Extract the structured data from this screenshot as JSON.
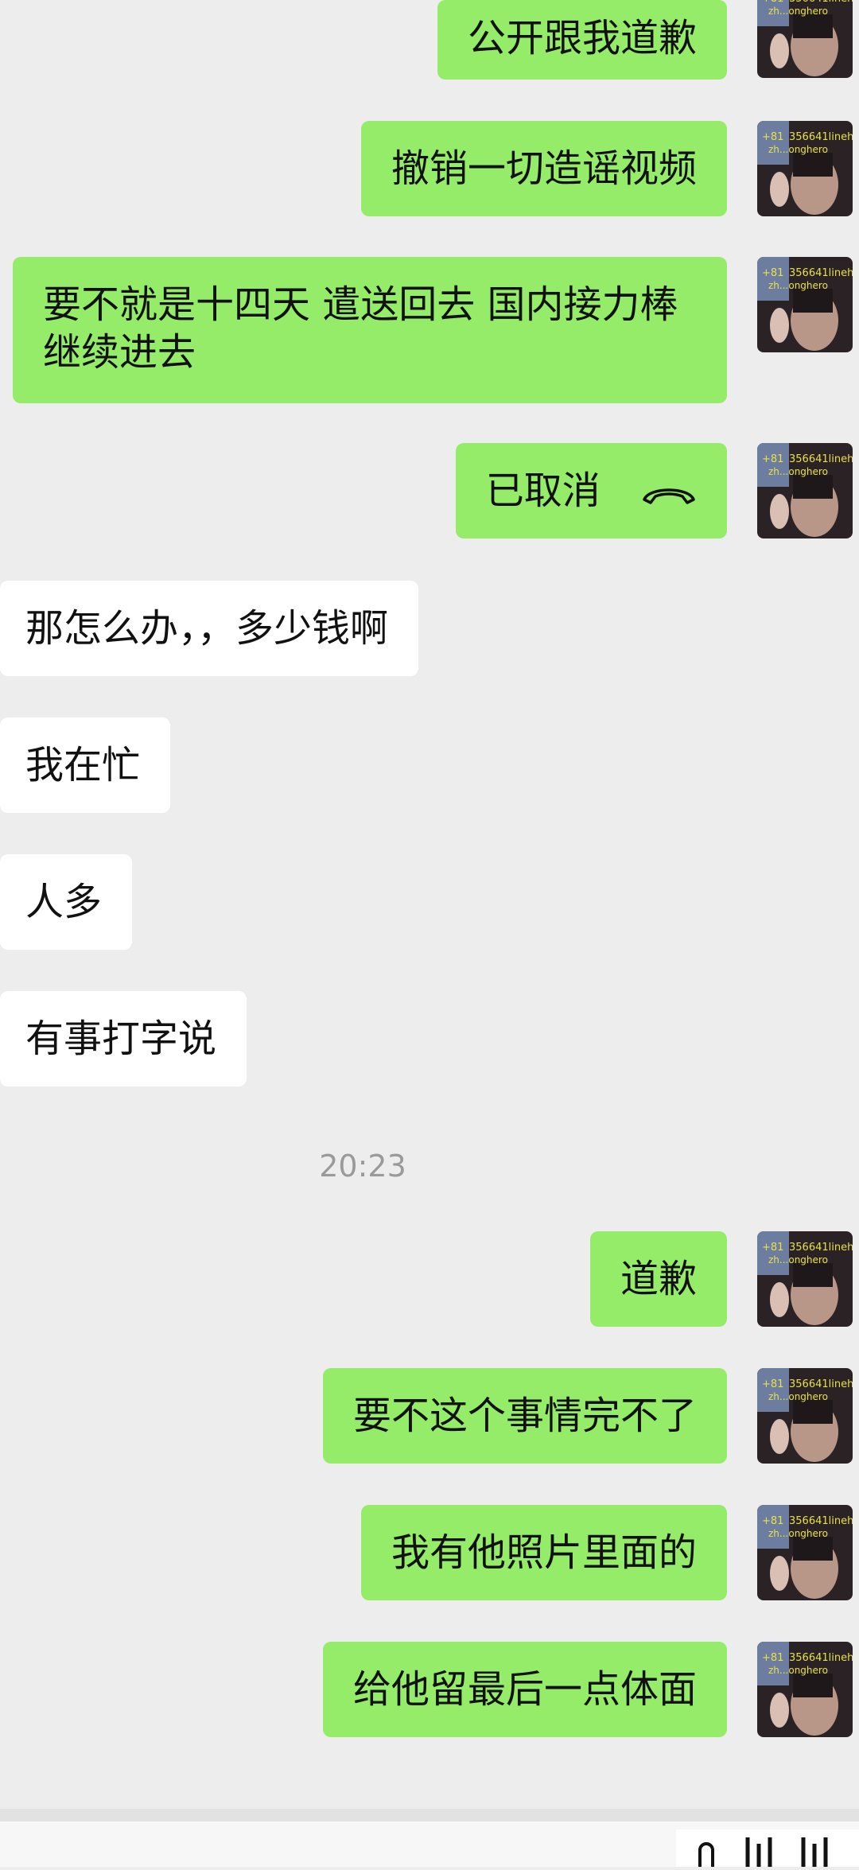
{
  "messages": [
    {
      "text": "公开跟我道歉",
      "dir": "out"
    },
    {
      "text": "撤销一切造谣视频",
      "dir": "out"
    },
    {
      "text": "要不就是十四天 遣送回去 国内接力棒继续进去",
      "dir": "out"
    },
    {
      "text": "已取消",
      "dir": "out",
      "type": "call-cancelled"
    },
    {
      "text": "那怎么办，，多少钱啊",
      "dir": "in"
    },
    {
      "text": "我在忙",
      "dir": "in"
    },
    {
      "text": "人多",
      "dir": "in"
    },
    {
      "text": "有事打字说",
      "dir": "in"
    },
    {
      "text": "道歉",
      "dir": "out"
    },
    {
      "text": "要不这个事情完不了",
      "dir": "out"
    },
    {
      "text": "我有他照片里面的",
      "dir": "out"
    },
    {
      "text": "给他留最后一点体面",
      "dir": "out"
    }
  ],
  "timestamp": "20:23",
  "avatar_text": {
    "line1": "+81",
    "line2": "356641lineh",
    "line3": "zh...onghero"
  },
  "colors": {
    "background": "#ededed",
    "outgoing_bubble": "#95ec69",
    "incoming_bubble": "#ffffff",
    "timestamp": "#9a9a9a"
  }
}
